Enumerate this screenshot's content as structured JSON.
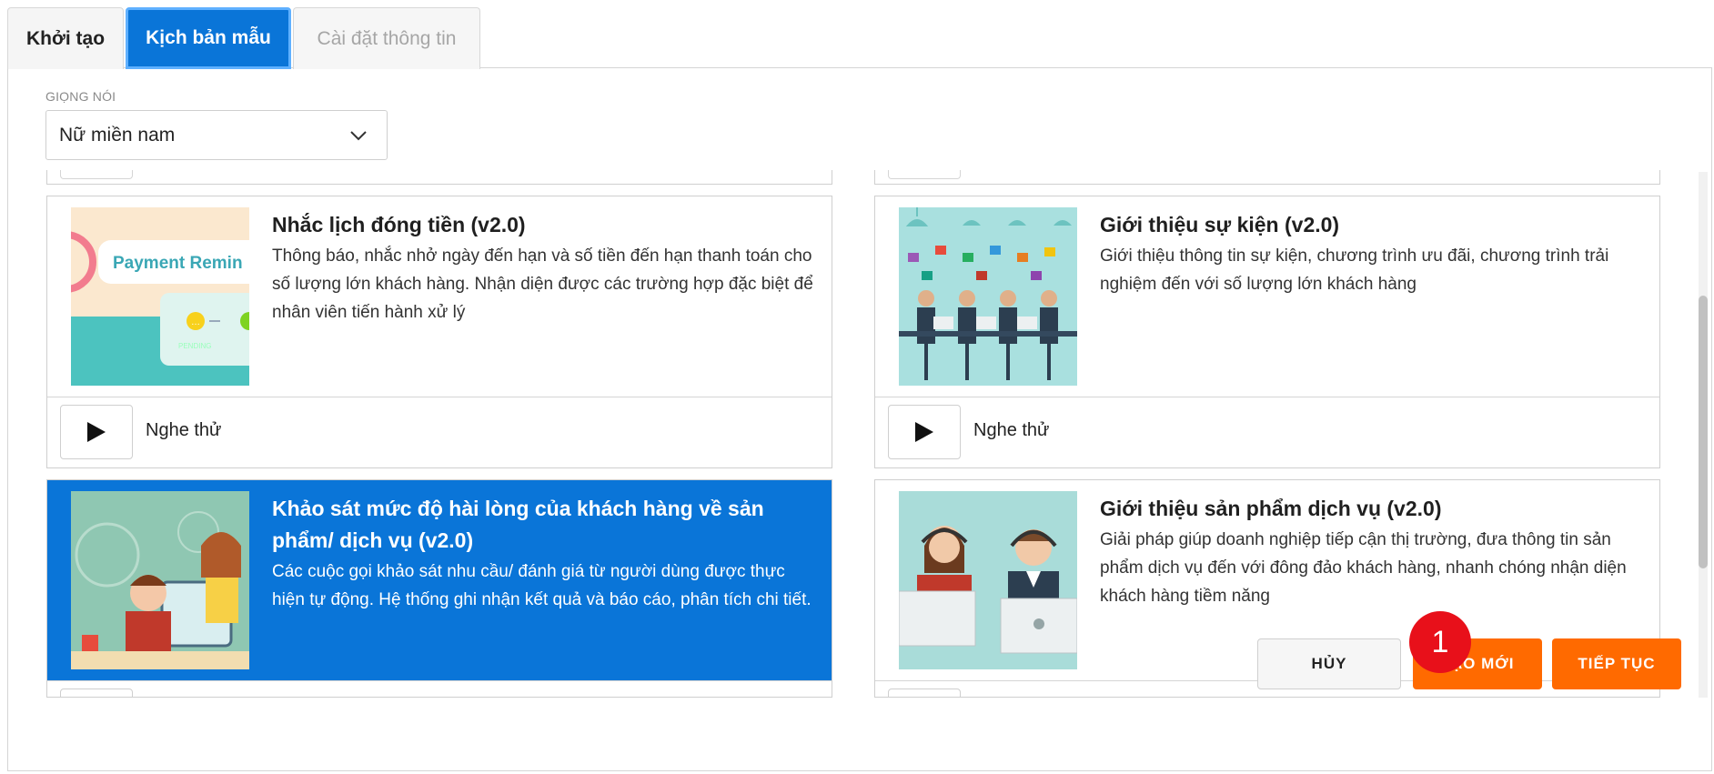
{
  "tabs": [
    {
      "label": "Khởi tạo"
    },
    {
      "label": "Kịch bản mẫu"
    },
    {
      "label": "Cài đặt thông tin"
    }
  ],
  "voice": {
    "label": "GIỌNG NÓI",
    "selected": "Nữ miền nam"
  },
  "templates": [
    {
      "title": "Nhắc lịch đóng tiền (v2.0)",
      "description": "Thông báo, nhắc nhở ngày đến hạn và số tiền đến hạn thanh toán cho số lượng lớn khách hàng. Nhận diện được các trường hợp đặc biệt để nhân viên tiến hành xử lý",
      "thumb_text": "Payment Remin",
      "thumb_sub": "PENDING",
      "play_label": "Nghe thử"
    },
    {
      "title": "Giới thiệu sự kiện (v2.0)",
      "description": "Giới thiệu thông tin sự kiện, chương trình ưu đãi, chương trình trải nghiệm đến với số lượng lớn khách hàng",
      "play_label": "Nghe thử"
    },
    {
      "title": "Khảo sát mức độ hài lòng của khách hàng về sản phẩm/ dịch vụ (v2.0)",
      "description": "Các cuộc gọi khảo sát nhu cầu/ đánh giá từ người dùng được thực hiện tự động. Hệ thống ghi nhận kết quả và báo cáo, phân tích chi tiết.",
      "selected": true
    },
    {
      "title": "Giới thiệu sản phẩm dịch vụ (v2.0)",
      "description": "Giải pháp giúp doanh nghiệp tiếp cận thị trường, đưa thông tin sản phẩm dịch vụ đến với đông đảo khách hàng, nhanh chóng nhận diện khách hàng tiềm năng"
    }
  ],
  "buttons": {
    "cancel": "HỦY",
    "create": "TẠO MỚI",
    "next": "TIẾP TỤC"
  },
  "annotation": {
    "badge": "1"
  },
  "colors": {
    "primary": "#0a75d8",
    "accent": "#ff6a00",
    "badge": "#e8101a"
  }
}
